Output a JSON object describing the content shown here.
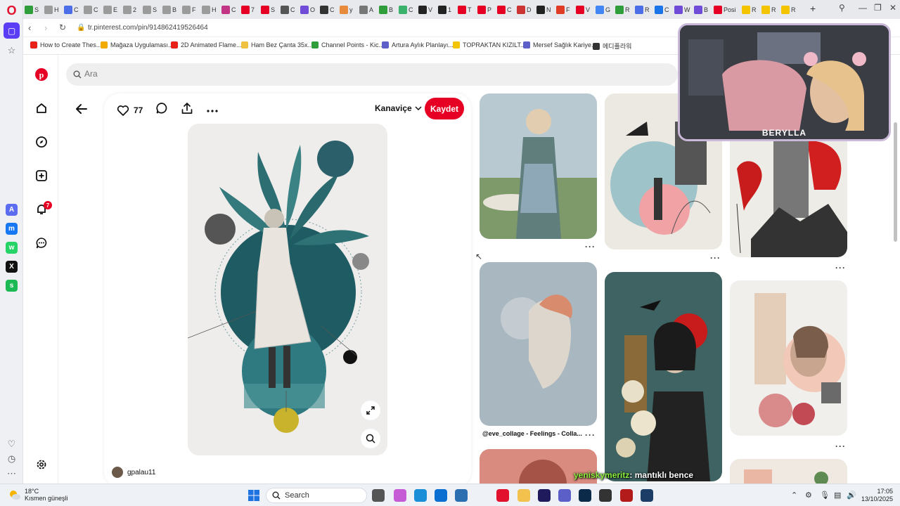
{
  "browser": {
    "url": "tr.pinterest.com/pin/914862419526464",
    "tabs": [
      {
        "label": "S",
        "color": "#2e9d3a"
      },
      {
        "label": "H",
        "color": "#9b9b9b"
      },
      {
        "label": "C",
        "color": "#4b6ee8"
      },
      {
        "label": "C",
        "color": "#9b9b9b"
      },
      {
        "label": "E",
        "color": "#9b9b9b"
      },
      {
        "label": "2",
        "color": "#9b9b9b"
      },
      {
        "label": "S",
        "color": "#9b9b9b"
      },
      {
        "label": "B",
        "color": "#9b9b9b"
      },
      {
        "label": "F",
        "color": "#9b9b9b"
      },
      {
        "label": "H",
        "color": "#9b9b9b"
      },
      {
        "label": "C",
        "color": "#c13584"
      },
      {
        "label": "7",
        "color": "#e60023"
      },
      {
        "label": "S",
        "color": "#e60023"
      },
      {
        "label": "C",
        "color": "#555555"
      },
      {
        "label": "O",
        "color": "#6f4bd8"
      },
      {
        "label": "C",
        "color": "#333333"
      },
      {
        "label": "y",
        "color": "#e88a3c"
      },
      {
        "label": "A",
        "color": "#777777"
      },
      {
        "label": "B",
        "color": "#2e9d3a"
      },
      {
        "label": "C",
        "color": "#3bb26b"
      },
      {
        "label": "V",
        "color": "#222222"
      },
      {
        "label": "1",
        "color": "#222222"
      },
      {
        "label": "T",
        "color": "#e60023"
      },
      {
        "label": "P",
        "color": "#e60023"
      },
      {
        "label": "C",
        "color": "#e60023"
      },
      {
        "label": "D",
        "color": "#cc3333"
      },
      {
        "label": "N",
        "color": "#222222"
      },
      {
        "label": "F",
        "color": "#e03b24"
      },
      {
        "label": "V",
        "color": "#e60023"
      },
      {
        "label": "G",
        "color": "#4285f4"
      },
      {
        "label": "R",
        "color": "#2e9d3a"
      },
      {
        "label": "R",
        "color": "#4b6ee8"
      },
      {
        "label": "C",
        "color": "#1a73e8"
      },
      {
        "label": "W",
        "color": "#6f4bd8"
      },
      {
        "label": "B",
        "color": "#6f4bd8"
      },
      {
        "label": "Posi",
        "color": "#e60023"
      },
      {
        "label": "R",
        "color": "#f5c400"
      },
      {
        "label": "R",
        "color": "#f5c400"
      },
      {
        "label": "R",
        "color": "#f5c400"
      }
    ],
    "bookmarks": [
      {
        "label": "How to Create Thes...",
        "color": "#e62117"
      },
      {
        "label": "Mağaza Uygulaması...",
        "color": "#f2a900"
      },
      {
        "label": "2D Animated Flame...",
        "color": "#e62117"
      },
      {
        "label": "Ham Bez Çanta 35x...",
        "color": "#f0c040"
      },
      {
        "label": "Channel Points - Kic...",
        "color": "#2e9d3a"
      },
      {
        "label": "Artura Aylık Planlayı...",
        "color": "#5b5fc7"
      },
      {
        "label": "TOPRAKTAN KIZILT...",
        "color": "#f5c400"
      },
      {
        "label": "Mersef Sağlık Kariye...",
        "color": "#5b5fc7"
      },
      {
        "label": "메디플라워",
        "color": "#333333"
      }
    ]
  },
  "rail": {
    "apps": [
      {
        "name": "aria",
        "color": "#5b6cf0",
        "glyph": "A"
      },
      {
        "name": "messenger",
        "color": "#1877f2",
        "glyph": "m"
      },
      {
        "name": "whatsapp",
        "color": "#25d366",
        "glyph": "w"
      },
      {
        "name": "x",
        "color": "#111111",
        "glyph": "X"
      },
      {
        "name": "spotify",
        "color": "#1db954",
        "glyph": "s"
      }
    ]
  },
  "pinterest": {
    "nav": {
      "notification_count": "7"
    },
    "search_placeholder": "Ara",
    "pin": {
      "likes": "77",
      "board": "Kanaviçe",
      "save_label": "Kaydet",
      "author": "gpalau11"
    },
    "grid_caption": "@eve_collage - Feelings - Colla..."
  },
  "stream": {
    "streamer": "BERYLLA",
    "chat_user": "yeniskymeritz",
    "chat_message": ": mantıklı bence"
  },
  "taskbar": {
    "temperature": "18°C",
    "weather": "Kısmen güneşli",
    "search_label": "Search",
    "time": "17:05",
    "date": "13/10/2025"
  }
}
